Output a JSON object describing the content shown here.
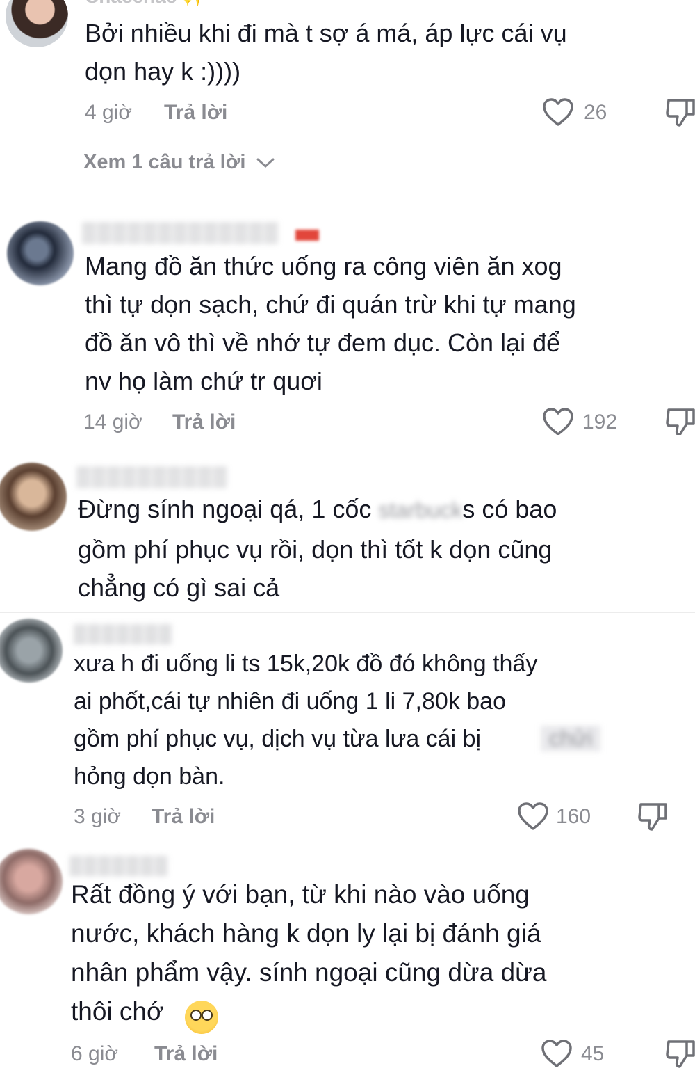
{
  "comments": [
    {
      "username": "Chacchac ✨",
      "text": "Bởi nhiều khi đi mà t sợ á má, áp lực cái vụ\ndọn hay k :))))",
      "time": "4 giờ",
      "reply_label": "Trả lời",
      "likes": "26",
      "view_replies": "Xem 1 câu trả lời"
    },
    {
      "username": "▒▒▒▒▒▒▒▒▒▒▒▒▒",
      "text": "Mang đồ ăn thức uống ra công viên ăn xog\nthì tự dọn sạch, chứ đi quán trừ khi tự mang\nđồ ăn vô thì về nhớ tự đem dục. Còn lại để\nnv họ làm chứ tr quơi",
      "time": "14 giờ",
      "reply_label": "Trả lời",
      "likes": "192"
    },
    {
      "username": "▒▒▒▒▒▒▒▒▒▒",
      "text_line1_a": "Đừng sính ngoại qá, 1 cốc",
      "text_line1_blur": "starbuck",
      "text_line1_b": "s có bao",
      "text_rest": "gồm phí phục vụ rồi, dọn thì tốt k dọn cũng\nchẳng có gì sai cả"
    },
    {
      "username": "▒▒▒▒▒▒▒",
      "text_a": "xưa h đi uống li ts 15k,20k đồ đó không thấy\nai phốt,cái tự nhiên đi uống 1 li 7,80k bao\ngồm phí phục vụ, dịch vụ từa lưa cái bị",
      "text_blur": "chửi",
      "text_b": "hỏng dọn bàn.",
      "time": "3 giờ",
      "reply_label": "Trả lời",
      "likes": "160"
    },
    {
      "username": "▒▒▒▒▒▒▒",
      "text": "Rất đồng ý với bạn, từ khi nào vào uống\nnước, khách hàng k dọn ly lại bị đánh giá\nnhân phẩm vậy. sính ngoại cũng dừa dừa\nthôi chớ",
      "time": "6 giờ",
      "reply_label": "Trả lời",
      "likes": "45"
    }
  ],
  "icons": {
    "like": "heart-outline-icon",
    "dislike": "thumbs-down-icon",
    "expand": "chevron-down-icon",
    "emoji": "flushed-face-emoji"
  },
  "colors": {
    "text": "#161823",
    "secondary": "#8a8b91",
    "background": "#ffffff"
  }
}
